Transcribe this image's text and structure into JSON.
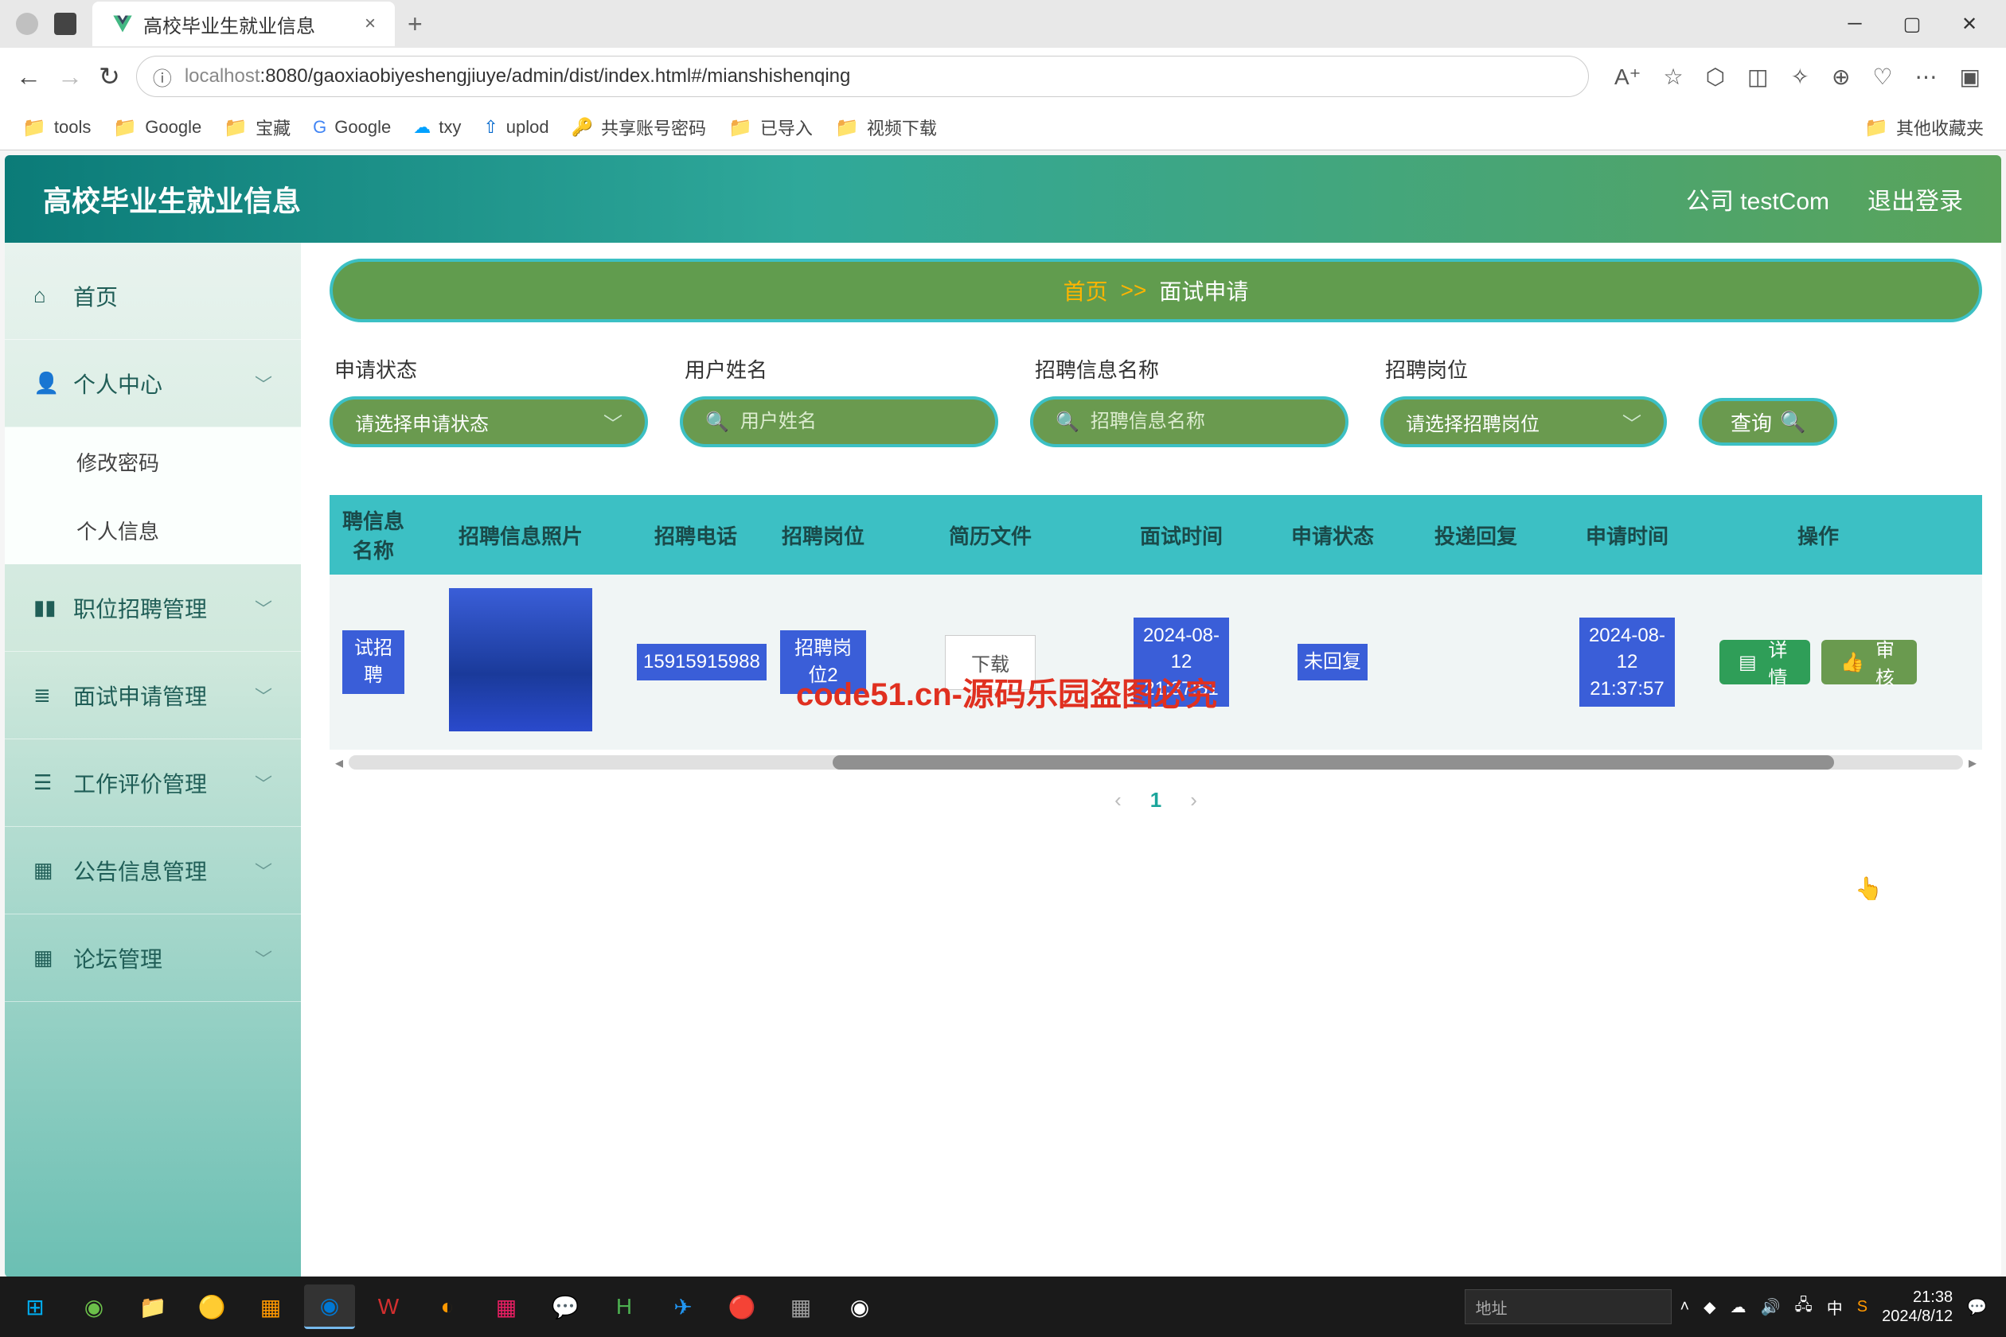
{
  "browser": {
    "tab_title": "高校毕业生就业信息",
    "url_host": "localhost",
    "url_port": ":8080",
    "url_path": "/gaoxiaobiyeshengjiuye/admin/dist/index.html#/mianshishenqing",
    "bookmarks": [
      "tools",
      "Google",
      "宝藏",
      "Google",
      "txy",
      "uplod",
      "共享账号密码",
      "已导入",
      "视频下载"
    ],
    "other_bookmarks": "其他收藏夹"
  },
  "app": {
    "title": "高校毕业生就业信息",
    "header_company": "公司 testCom",
    "header_logout": "退出登录"
  },
  "sidebar": {
    "home": "首页",
    "personal_center": "个人中心",
    "sub_change_pwd": "修改密码",
    "sub_personal_info": "个人信息",
    "job_mgmt": "职位招聘管理",
    "interview_mgmt": "面试申请管理",
    "eval_mgmt": "工作评价管理",
    "notice_mgmt": "公告信息管理",
    "forum_mgmt": "论坛管理"
  },
  "breadcrumb": {
    "home": "首页",
    "sep": ">>",
    "current": "面试申请"
  },
  "filters": {
    "status_label": "申请状态",
    "status_placeholder": "请选择申请状态",
    "user_label": "用户姓名",
    "user_placeholder": "用户姓名",
    "jobname_label": "招聘信息名称",
    "jobname_placeholder": "招聘信息名称",
    "position_label": "招聘岗位",
    "position_placeholder": "请选择招聘岗位",
    "search_btn": "查询"
  },
  "table": {
    "headers": {
      "h1": "聘信息名称",
      "h2": "招聘信息照片",
      "h3": "招聘电话",
      "h4": "招聘岗位",
      "h5": "简历文件",
      "h6": "面试时间",
      "h7": "申请状态",
      "h8": "投递回复",
      "h9": "申请时间",
      "h10": "操作"
    },
    "row": {
      "c1": "试招聘",
      "c3": "15915915988",
      "c4": "招聘岗位2",
      "c5_btn": "下载",
      "c6": "2024-08-12 21:37:51",
      "c7": "未回复",
      "c8": "",
      "c9": "2024-08-12 21:37:57",
      "detail_btn": "详情",
      "audit_btn": "审核"
    }
  },
  "pagination": {
    "page": "1"
  },
  "overlay": "code51.cn-源码乐园盗图必究",
  "taskbar": {
    "addr_label": "地址",
    "tray_ime": "中",
    "time": "21:38",
    "date": "2024/8/12"
  }
}
